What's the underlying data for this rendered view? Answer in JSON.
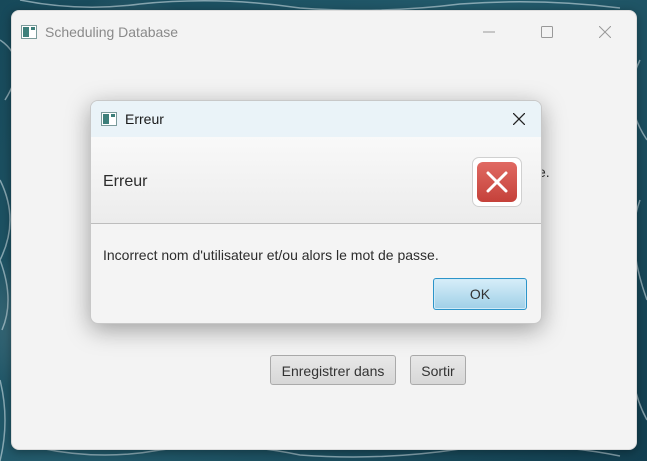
{
  "main_window": {
    "title": "Scheduling Database",
    "partial_text": "e.",
    "buttons": {
      "save_label": "Enregistrer dans",
      "exit_label": "Sortir"
    }
  },
  "dialog": {
    "title": "Erreur",
    "header_text": "Erreur",
    "message": "Incorrect nom d'utilisateur et/ou alors le mot de passe.",
    "ok_label": "OK",
    "icon": "error-x-icon"
  },
  "colors": {
    "error_red": "#c5413a",
    "ok_button_border": "#2c94c9",
    "ok_button_fill": "#9fcfe7",
    "dialog_titlebar": "#eaf3f8"
  }
}
